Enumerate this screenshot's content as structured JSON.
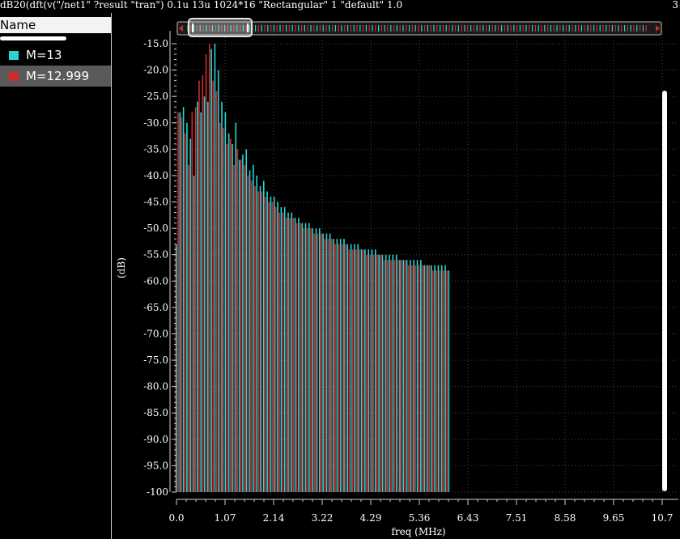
{
  "window": {
    "title": "dB20(dft(v(\"/net1\" ?result \"tran\") 0.1u 13u 1024*16 \"Rectangular\" 1 \"default\" 1.0",
    "corner_number": "3"
  },
  "legend": {
    "header": "Name",
    "items": [
      {
        "label": "M=13",
        "color": "#2ad4d4"
      },
      {
        "label": "M=12.999",
        "color": "#d42a2a"
      }
    ]
  },
  "colors": {
    "background": "#000000",
    "grid": "#444444",
    "axis": "#cfcfcf",
    "scroller_track": "#bfbfbf",
    "scroller_thumb": "#e6e6e6"
  },
  "chart_data": {
    "type": "bar",
    "xlabel": "freq (MHz)",
    "ylabel": "(dB)",
    "xlim": [
      0,
      10.7
    ],
    "ylim": [
      -100,
      -15
    ],
    "grid": true,
    "legend_position": "left-panel",
    "x_ticks": [
      "0.0",
      "1.07",
      "2.14",
      "3.22",
      "4.29",
      "5.36",
      "6.43",
      "7.51",
      "8.58",
      "9.65",
      "10.7"
    ],
    "y_ticks": [
      "-15.0",
      "-20.0",
      "-25.0",
      "-30.0",
      "-35.0",
      "-40.0",
      "-45.0",
      "-50.0",
      "-55.0",
      "-60.0",
      "-65.0",
      "-70.0",
      "-75.0",
      "-80.0",
      "-85.0",
      "-90.0",
      "-95.0",
      "-100"
    ],
    "bar_spacing_mhz": 0.0769,
    "series": [
      {
        "name": "M=13",
        "color": "#2ad4d4",
        "values": [
          -53,
          -28,
          -27,
          -30,
          -33,
          -40,
          -26,
          -28,
          -25,
          -26,
          -16,
          -15,
          -20,
          -26,
          -28,
          -32,
          -34,
          -30,
          -37,
          -36,
          -35,
          -39,
          -38,
          -40,
          -42,
          -41,
          -43,
          -44,
          -44,
          -45,
          -46,
          -46,
          -47,
          -47,
          -48,
          -48,
          -49,
          -49,
          -49,
          -50,
          -50,
          -50,
          -51,
          -51,
          -51,
          -52,
          -52,
          -52,
          -52,
          -53,
          -53,
          -53,
          -53,
          -54,
          -54,
          -54,
          -54,
          -54,
          -55,
          -55,
          -55,
          -55,
          -55,
          -55,
          -56,
          -56,
          -56,
          -56,
          -56,
          -56,
          -56,
          -57,
          -57,
          -57,
          -57,
          -57,
          -57,
          -57,
          -58
        ]
      },
      {
        "name": "M=12.999",
        "color": "#d42a2a",
        "values": [
          -53,
          -28,
          -29,
          -32,
          -38,
          -28,
          -27,
          -22,
          -21,
          -17,
          -15,
          -22,
          -24,
          -30,
          -31,
          -34,
          -33,
          -38,
          -35,
          -37,
          -38,
          -40,
          -41,
          -42,
          -43,
          -43,
          -44,
          -45,
          -45,
          -46,
          -47,
          -47,
          -48,
          -48,
          -48,
          -49,
          -49,
          -50,
          -50,
          -50,
          -51,
          -51,
          -51,
          -52,
          -52,
          -52,
          -53,
          -53,
          -53,
          -53,
          -54,
          -54,
          -54,
          -54,
          -54,
          -55,
          -55,
          -55,
          -55,
          -55,
          -56,
          -56,
          -56,
          -56,
          -56,
          -56,
          -56,
          -57,
          -57,
          -57,
          -57,
          -57,
          -57,
          -57,
          -58,
          -58,
          -58,
          -58,
          -58
        ]
      }
    ]
  }
}
